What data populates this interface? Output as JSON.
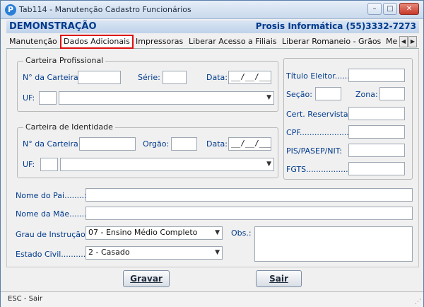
{
  "window": {
    "title": "Tab114 - Manutenção Cadastro Funcionários",
    "app_icon": "P",
    "minimize": "–",
    "maximize": "□",
    "close": "✕"
  },
  "header": {
    "left": "DEMONSTRAÇÃO",
    "right": "Prosis Informática (55)3332-7273"
  },
  "tabs": [
    {
      "label": "Manutenção"
    },
    {
      "label": "Dados Adicionais",
      "active": true
    },
    {
      "label": "Impressoras"
    },
    {
      "label": "Liberar Acesso a Filiais"
    },
    {
      "label": "Liberar Romaneio - Grãos"
    },
    {
      "label": "Me"
    }
  ],
  "tab_scroll": {
    "left": "◀",
    "right": "▶"
  },
  "carteira_profissional": {
    "legend": "Carteira Profissional",
    "numero_label": "N° da Carteira:",
    "serie_label": "Série:",
    "data_label": "Data:",
    "data_value": "__/__/____",
    "uf_label": "UF:"
  },
  "carteira_identidade": {
    "legend": "Carteira de Identidade",
    "numero_label": "N° da Carteira:",
    "orgao_label": "Orgão:",
    "data_label": "Data:",
    "data_value": "__/__/____",
    "uf_label": "UF:"
  },
  "right_group": {
    "titulo_label": "Título Eleitor.......:",
    "secao_label": "Seção:",
    "zona_label": "Zona:",
    "reservista_label": "Cert. Reservista:",
    "cpf_label": "CPF.......................:",
    "pis_label": "PIS/PASEP/NIT:",
    "fgts_label": "FGTS.......................:"
  },
  "pais": {
    "pai_label": "Nome do Pai........:",
    "mae_label": "Nome da Mãe.......:"
  },
  "grau": {
    "label": "Grau de Instrução:",
    "value": "07 - Ensino Médio Completo"
  },
  "estado_civil": {
    "label": "Estado Civil............:",
    "value": "2 - Casado"
  },
  "obs": {
    "label": "Obs.:"
  },
  "buttons": {
    "gravar": "Gravar",
    "sair": "Sair"
  },
  "status": {
    "text": "ESC - Sair"
  },
  "icons": {
    "dropdown": "▼",
    "grip": "⋰"
  }
}
